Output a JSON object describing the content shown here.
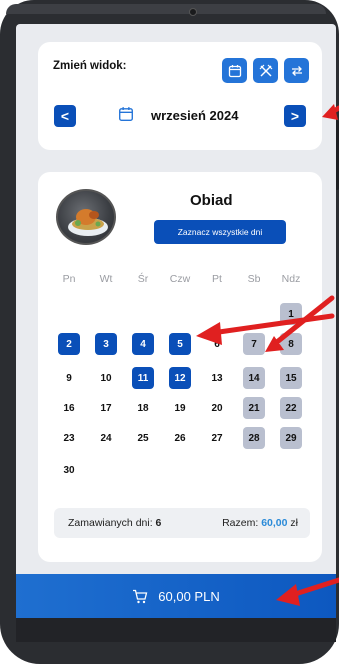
{
  "view": {
    "label": "Zmień widok:"
  },
  "nav": {
    "month": "wrzesień 2024",
    "prev": "<",
    "next": ">"
  },
  "meal": {
    "title": "Obiad",
    "select_all": "Zaznacz wszystkie dni"
  },
  "weekdays": [
    "Pn",
    "Wt",
    "Śr",
    "Czw",
    "Pt",
    "Sb",
    "Ndz"
  ],
  "days": [
    {
      "d": "1",
      "state": "weekend"
    },
    {
      "d": "2",
      "state": "selected"
    },
    {
      "d": "3",
      "state": "selected"
    },
    {
      "d": "4",
      "state": "selected"
    },
    {
      "d": "5",
      "state": "selected"
    },
    {
      "d": "6",
      "state": "normal"
    },
    {
      "d": "7",
      "state": "weekend"
    },
    {
      "d": "8",
      "state": "weekend"
    },
    {
      "d": "9",
      "state": "normal"
    },
    {
      "d": "10",
      "state": "normal"
    },
    {
      "d": "11",
      "state": "selected"
    },
    {
      "d": "12",
      "state": "selected"
    },
    {
      "d": "13",
      "state": "normal"
    },
    {
      "d": "14",
      "state": "weekend"
    },
    {
      "d": "15",
      "state": "weekend"
    },
    {
      "d": "16",
      "state": "normal"
    },
    {
      "d": "17",
      "state": "normal"
    },
    {
      "d": "18",
      "state": "normal"
    },
    {
      "d": "19",
      "state": "normal"
    },
    {
      "d": "20",
      "state": "normal"
    },
    {
      "d": "21",
      "state": "weekend"
    },
    {
      "d": "22",
      "state": "weekend"
    },
    {
      "d": "23",
      "state": "normal"
    },
    {
      "d": "24",
      "state": "normal"
    },
    {
      "d": "25",
      "state": "normal"
    },
    {
      "d": "26",
      "state": "normal"
    },
    {
      "d": "27",
      "state": "normal"
    },
    {
      "d": "28",
      "state": "weekend"
    },
    {
      "d": "29",
      "state": "weekend"
    },
    {
      "d": "30",
      "state": "normal"
    }
  ],
  "summary": {
    "ordered_label": "Zamawianych dni:",
    "ordered_count": "6",
    "total_label": "Razem:",
    "total_amount": "60,00",
    "currency": "zł"
  },
  "cart": {
    "amount": "60,00 PLN"
  },
  "colors": {
    "primary": "#0a4fb8",
    "accent": "#2474d8",
    "weekend": "#b9bfcf",
    "amount": "#2a8ad8",
    "arrow": "#e02020"
  },
  "icons": [
    "calendar-icon",
    "utensils-icon",
    "swap-icon",
    "cart-icon",
    "avatar-meal-image"
  ]
}
